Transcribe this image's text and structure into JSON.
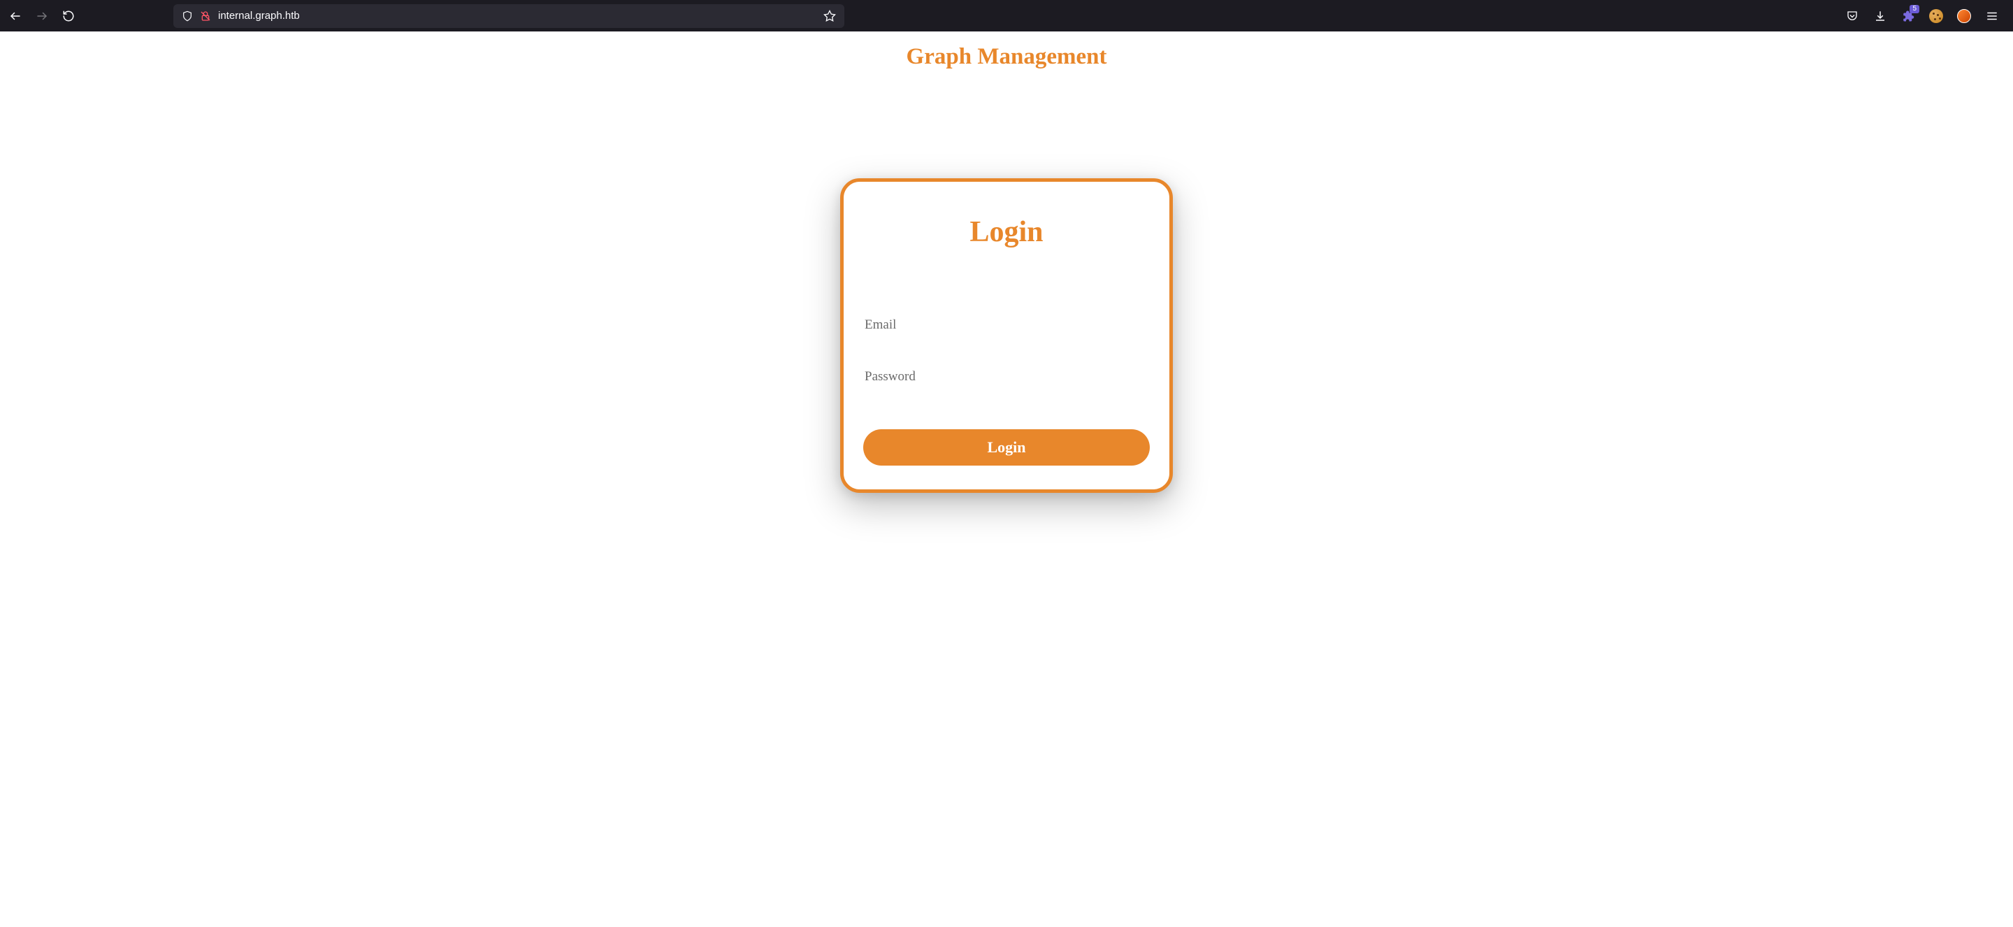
{
  "browser": {
    "url": "internal.graph.htb",
    "badge_count": "5"
  },
  "page": {
    "title": "Graph Management"
  },
  "login": {
    "heading": "Login",
    "email_placeholder": "Email",
    "password_placeholder": "Password",
    "button_label": "Login"
  },
  "colors": {
    "accent": "#e8872b"
  }
}
